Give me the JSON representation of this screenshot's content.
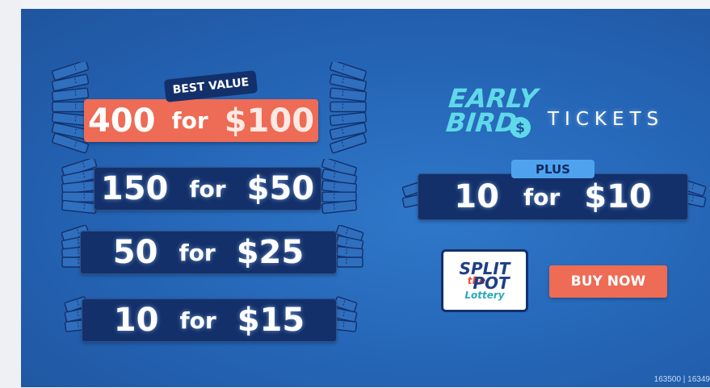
{
  "offers": [
    {
      "qty": "400",
      "for": "for",
      "price": "$100",
      "badge": "BEST VALUE"
    },
    {
      "qty": "150",
      "for": "for",
      "price": "$50"
    },
    {
      "qty": "50",
      "for": "for",
      "price": "$25"
    },
    {
      "qty": "10",
      "for": "for",
      "price": "$15"
    }
  ],
  "promo": {
    "early": "EARLY",
    "bird": "BIRD",
    "tickets": "TICKETS",
    "plus": "PLUS",
    "qty": "10",
    "for": "for",
    "price": "$10"
  },
  "logo": {
    "split": "SPLIT",
    "the": "the",
    "pot": "POT",
    "lottery": "Lottery"
  },
  "buy_button": "BUY NOW",
  "footer_ids": "163500 | 16349",
  "colors": {
    "background": "#2463b4",
    "bar": "#13306a",
    "accent": "#ee6b55",
    "early_bird": "#5fd9e8",
    "plus_badge": "#4fa3ee"
  },
  "icons": [
    "ticket-stack-icon",
    "dollar-sign-icon"
  ]
}
